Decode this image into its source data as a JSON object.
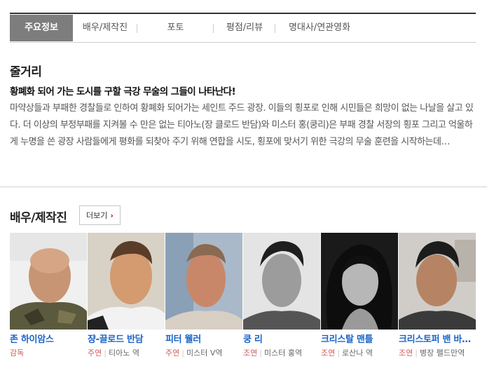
{
  "tabs": [
    {
      "label": "주요정보",
      "active": true
    },
    {
      "label": "배우/제작진"
    },
    {
      "label": "포토"
    },
    {
      "label": "평점/리뷰"
    },
    {
      "label": "명대사/연관영화"
    }
  ],
  "synopsis": {
    "section_title": "줄거리",
    "headline": "황폐화 되어 가는 도시를 구할 극강 무술의 그들이 나타난다!",
    "body": "마약상들과 부패한 경찰들로 인하여 황폐화 되어가는 세인트 주드 광장. 이들의 횡포로 인해 시민들은 희망이 없는 나날을 살고 있다. 더 이상의 부정부패를 지켜볼 수 만은 없는 티아노(장 클로드 반담)와 미스터 홍(쿵리)은 부패 경찰 서장의 횡포 그리고 억울하게 누명을 쓴 광장 사람들에게 평화를 되찾아 주기 위해 연합을 시도, 횡포에 맞서기 위한 극강의 무술 훈련을 시작하는데…"
  },
  "cast_section": {
    "title": "배우/제작진",
    "more_label": "더보기",
    "members": [
      {
        "name": "존 하이암스",
        "type": "감독",
        "role": ""
      },
      {
        "name": "쟝-끌로드 반담",
        "type": "주연",
        "role": "티아노 역"
      },
      {
        "name": "피터 웰러",
        "type": "주연",
        "role": "미스터 V역"
      },
      {
        "name": "쿵 리",
        "type": "조연",
        "role": "미스터 홍역"
      },
      {
        "name": "크리스탈 맨틀",
        "type": "조연",
        "role": "로산나 역"
      },
      {
        "name": "크리스토퍼 밴 바렌버그",
        "type": "조연",
        "role": "병장 펠드만역"
      }
    ]
  }
}
